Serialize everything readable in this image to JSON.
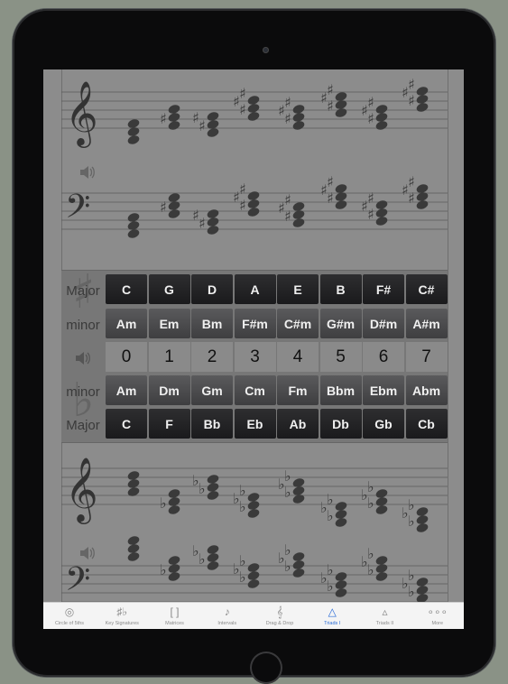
{
  "key_grid": {
    "rows": [
      {
        "label": "Major",
        "style": "dark",
        "cells": [
          "C",
          "G",
          "D",
          "A",
          "E",
          "B",
          "F#",
          "C#"
        ]
      },
      {
        "label": "minor",
        "style": "mid",
        "cells": [
          "Am",
          "Em",
          "Bm",
          "F#m",
          "C#m",
          "G#m",
          "D#m",
          "A#m"
        ]
      },
      {
        "label": "",
        "style": "numbers",
        "cells": [
          "0",
          "1",
          "2",
          "3",
          "4",
          "5",
          "6",
          "7"
        ]
      },
      {
        "label": "minor",
        "style": "mid",
        "cells": [
          "Am",
          "Dm",
          "Gm",
          "Cm",
          "Fm",
          "Bbm",
          "Ebm",
          "Abm"
        ]
      },
      {
        "label": "Major",
        "style": "dark",
        "cells": [
          "C",
          "F",
          "Bb",
          "Eb",
          "Ab",
          "Db",
          "Gb",
          "Cb"
        ]
      }
    ]
  },
  "tabs": [
    {
      "label": "Circle of 5ths",
      "icon": "circle-of-fifths-icon",
      "glyph": "◎",
      "active": false
    },
    {
      "label": "Key Signatures",
      "icon": "key-signature-icon",
      "glyph": "♯♭",
      "active": false
    },
    {
      "label": "Matrices",
      "icon": "matrix-bracket-icon",
      "glyph": "[ ]",
      "active": false
    },
    {
      "label": "Intervals",
      "icon": "eighth-note-icon",
      "glyph": "♪",
      "active": false
    },
    {
      "label": "Drag & Drop",
      "icon": "staff-drag-icon",
      "glyph": "𝄞",
      "active": false
    },
    {
      "label": "Triads I",
      "icon": "triangle-icon",
      "glyph": "△",
      "active": true
    },
    {
      "label": "Triads II",
      "icon": "small-triangle-icon",
      "glyph": "▵",
      "active": false
    },
    {
      "label": "More",
      "icon": "more-dots-icon",
      "glyph": "∘∘∘",
      "active": false
    }
  ],
  "colors": {
    "active_tab": "#2a6cd6",
    "screen_bg": "#8c8c8c",
    "cell_dark": "#1f1f21"
  }
}
